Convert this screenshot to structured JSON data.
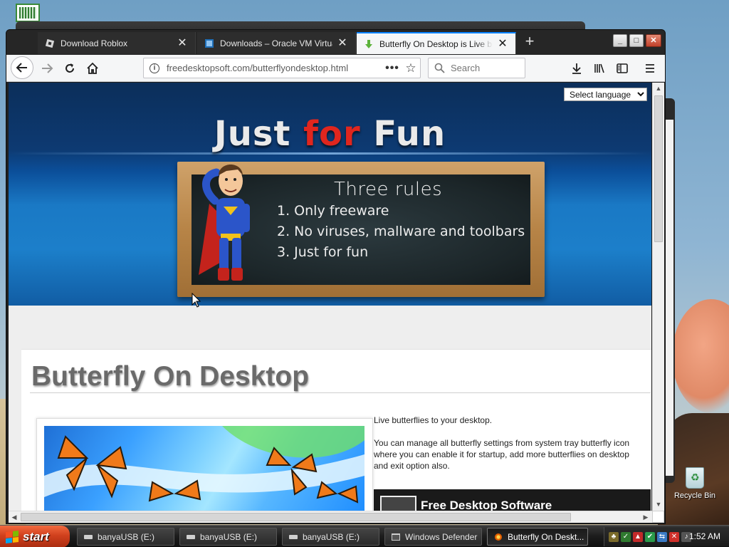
{
  "browser": {
    "tabs": [
      {
        "label": "Download Roblox",
        "active": false
      },
      {
        "label": "Downloads – Oracle VM VirtualBox",
        "active": false
      },
      {
        "label": "Butterfly On Desktop is Live butterflies",
        "active": true
      }
    ],
    "url_prefix": "freedesktopsoft.com",
    "url_path": "/butterflyondesktop.html",
    "search_placeholder": "Search"
  },
  "page": {
    "language_select": "Select language",
    "hero_title_1": "Just ",
    "hero_title_2": "for",
    "hero_title_3": " Fun",
    "rules_title": "Three rules",
    "rules": [
      "1. Only freeware",
      "2. No viruses, mallware and toolbars",
      "3. Just for fun"
    ],
    "title": "Butterfly On Desktop",
    "desc_1": "Live butterflies to your desktop.",
    "desc_2": "You can manage all butterfly settings from system tray butterfly icon where you can enable it for startup, add more butterflies on desktop and exit option also.",
    "fds_title": "Free Desktop Software"
  },
  "desktop": {
    "recycle_bin": "Recycle Bin"
  },
  "taskbar": {
    "start": "start",
    "tasks": [
      {
        "label": "banyaUSB (E:)",
        "active": false
      },
      {
        "label": "banyaUSB (E:)",
        "active": false
      },
      {
        "label": "banyaUSB (E:)",
        "active": false
      },
      {
        "label": "Windows Defender",
        "active": false
      },
      {
        "label": "Butterfly On Deskt...",
        "active": true
      }
    ],
    "clock": "1:52 AM"
  },
  "colors": {
    "accent": "#0a84ff",
    "hero_red": "#e0261e",
    "start_orange": "#d0401d"
  }
}
